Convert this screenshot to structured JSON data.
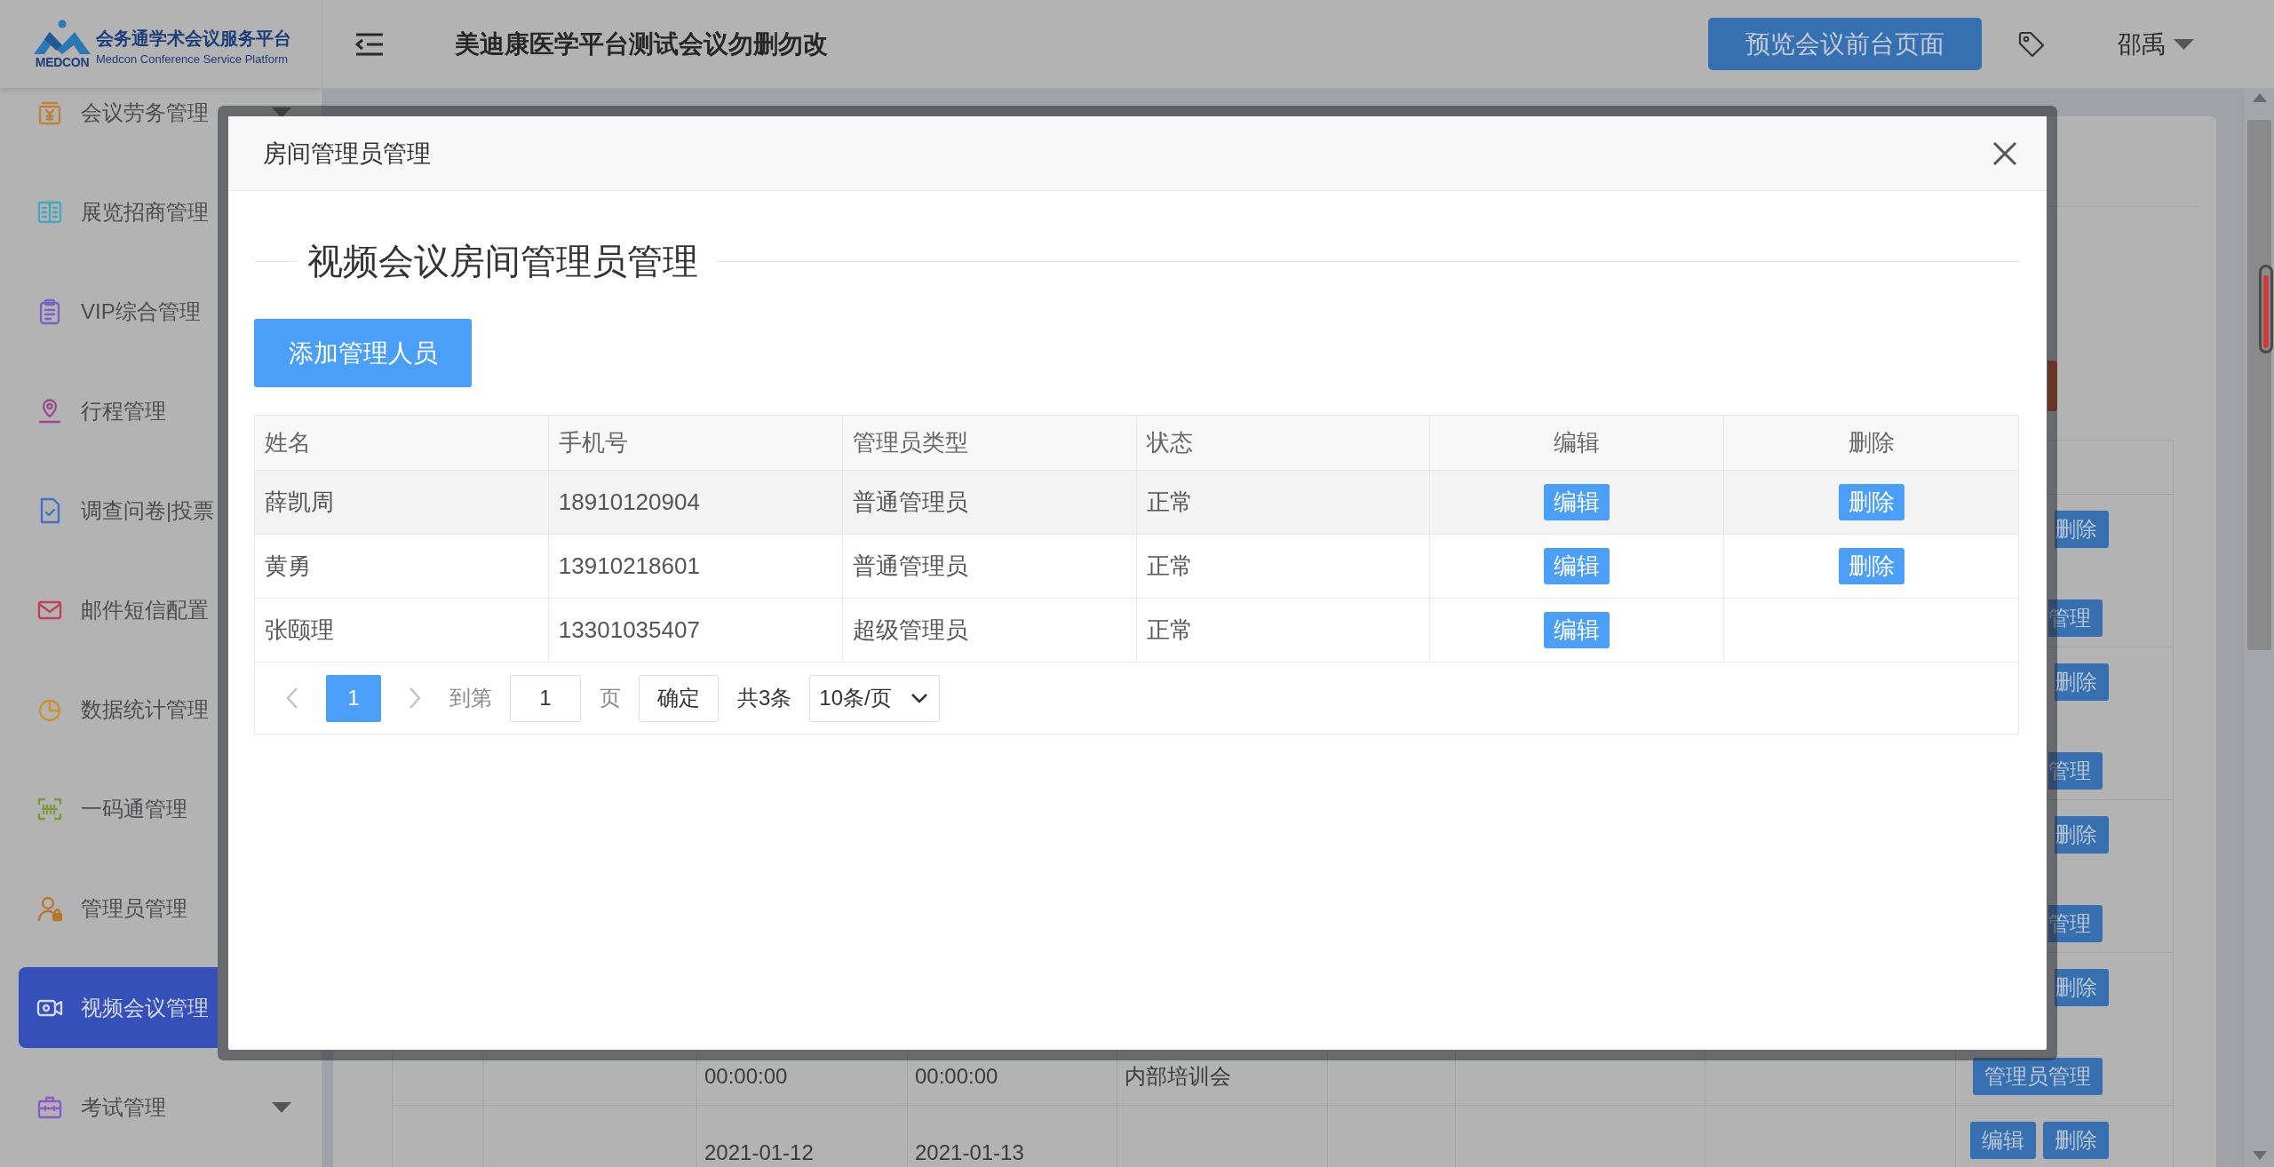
{
  "sidebar": {
    "logo": {
      "title": "会务通学术会议服务平台",
      "wordmark": "MEDCON",
      "subtitle": "Medcon Conference Service Platform"
    },
    "items": [
      {
        "label": "会议劳务管理",
        "selected": false,
        "has_submenu": true
      },
      {
        "label": "展览招商管理",
        "selected": false,
        "has_submenu": false
      },
      {
        "label": "VIP综合管理",
        "selected": false,
        "has_submenu": false
      },
      {
        "label": "行程管理",
        "selected": false,
        "has_submenu": false
      },
      {
        "label": "调查问卷|投票",
        "selected": false,
        "has_submenu": false
      },
      {
        "label": "邮件短信配置",
        "selected": false,
        "has_submenu": false
      },
      {
        "label": "数据统计管理",
        "selected": false,
        "has_submenu": false
      },
      {
        "label": "一码通管理",
        "selected": false,
        "has_submenu": false
      },
      {
        "label": "管理员管理",
        "selected": false,
        "has_submenu": false
      },
      {
        "label": "视频会议管理",
        "selected": true,
        "has_submenu": false
      },
      {
        "label": "考试管理",
        "selected": false,
        "has_submenu": true
      }
    ]
  },
  "header": {
    "title": "美迪康医学平台测试会议勿删勿改",
    "preview_button": "预览会议前台页面",
    "user": "邵禹"
  },
  "background_table": {
    "rows": [
      {
        "top_buttons": [
          {
            "label": "删除",
            "kind": "clipped"
          }
        ],
        "bottom_buttons": [
          {
            "label": "管理",
            "kind": "clipped"
          }
        ]
      },
      {
        "top_buttons": [
          {
            "label": "删除",
            "kind": "clipped"
          }
        ],
        "bottom_buttons": [
          {
            "label": "管理",
            "kind": "clipped"
          }
        ]
      },
      {
        "top_buttons": [
          {
            "label": "删除",
            "kind": "clipped"
          }
        ],
        "bottom_buttons": [
          {
            "label": "管理",
            "kind": "clipped"
          }
        ]
      },
      {
        "column_3": {
          "second_line": "00:00:00"
        },
        "column_4": {
          "second_line": "00:00:00"
        },
        "column_5": {
          "second_line": "内部培训会"
        },
        "top_buttons": [
          {
            "label": "删除",
            "kind": "clipped"
          }
        ],
        "bottom_buttons": [
          {
            "label": "管理员管理",
            "kind": "full"
          }
        ]
      },
      {
        "column_3": {
          "first_line": "2021-01-12"
        },
        "column_4": {
          "first_line": "2021-01-13"
        },
        "top_buttons": [
          {
            "label": "编辑",
            "kind": "full"
          },
          {
            "label": "删除",
            "kind": "full"
          }
        ]
      }
    ]
  },
  "dialog": {
    "title": "房间管理员管理",
    "section_title": "视频会议房间管理员管理",
    "add_button": "添加管理人员",
    "table": {
      "columns": [
        {
          "label": "姓名",
          "kind": "text"
        },
        {
          "label": "手机号",
          "kind": "text"
        },
        {
          "label": "管理员类型",
          "kind": "text"
        },
        {
          "label": "状态",
          "kind": "text"
        },
        {
          "label": "编辑",
          "kind": "button"
        },
        {
          "label": "删除",
          "kind": "button"
        }
      ],
      "rows": [
        {
          "cells": [
            "薛凯周",
            "18910120904",
            "普通管理员",
            "正常",
            "编辑",
            "删除"
          ],
          "highlighted": true
        },
        {
          "cells": [
            "黄勇",
            "13910218601",
            "普通管理员",
            "正常",
            "编辑",
            "删除"
          ],
          "highlighted": false
        },
        {
          "cells": [
            "张颐理",
            "13301035407",
            "超级管理员",
            "正常",
            "编辑"
          ],
          "highlighted": false
        }
      ]
    },
    "pagination": {
      "pages": [
        {
          "label": "1",
          "selected": true
        }
      ],
      "goto_label": "到第",
      "page_input": "1",
      "page_suffix": "页",
      "confirm_button": "确定",
      "total": "共3条",
      "page_size": "10条/页"
    }
  }
}
